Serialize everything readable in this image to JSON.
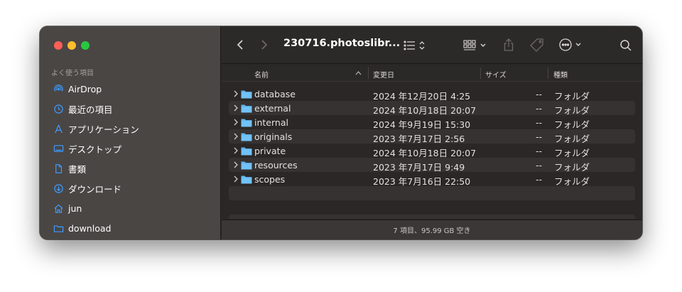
{
  "window": {
    "title": "230716.photoslibr...",
    "status": "7 項目、95.99 GB 空き"
  },
  "sidebar": {
    "section": "よく使う項目",
    "items": [
      {
        "label": "AirDrop",
        "icon": "airdrop-icon"
      },
      {
        "label": "最近の項目",
        "icon": "clock-icon"
      },
      {
        "label": "アプリケーション",
        "icon": "applications-icon"
      },
      {
        "label": "デスクトップ",
        "icon": "desktop-icon"
      },
      {
        "label": "書類",
        "icon": "document-icon"
      },
      {
        "label": "ダウンロード",
        "icon": "download-icon"
      },
      {
        "label": "jun",
        "icon": "home-icon"
      },
      {
        "label": "download",
        "icon": "folder-icon"
      }
    ]
  },
  "columns": {
    "name": "名前",
    "date": "変更日",
    "size": "サイズ",
    "kind": "種類"
  },
  "files": [
    {
      "name": "database",
      "date": "2024 年12月20日 4:25",
      "size": "--",
      "kind": "フォルダ"
    },
    {
      "name": "external",
      "date": "2024 年10月18日 20:07",
      "size": "--",
      "kind": "フォルダ"
    },
    {
      "name": "internal",
      "date": "2024 年9月19日 15:30",
      "size": "--",
      "kind": "フォルダ"
    },
    {
      "name": "originals",
      "date": "2023 年7月17日 2:56",
      "size": "--",
      "kind": "フォルダ"
    },
    {
      "name": "private",
      "date": "2024 年10月18日 20:07",
      "size": "--",
      "kind": "フォルダ"
    },
    {
      "name": "resources",
      "date": "2023 年7月17日 9:49",
      "size": "--",
      "kind": "フォルダ"
    },
    {
      "name": "scopes",
      "date": "2023 年7月16日 22:50",
      "size": "--",
      "kind": "フォルダ"
    }
  ],
  "colors": {
    "sidebar": "#4a4644",
    "content": "#2a2726",
    "accent_folder": "#5fb4f0",
    "sidebar_icon": "#3d9bff"
  }
}
